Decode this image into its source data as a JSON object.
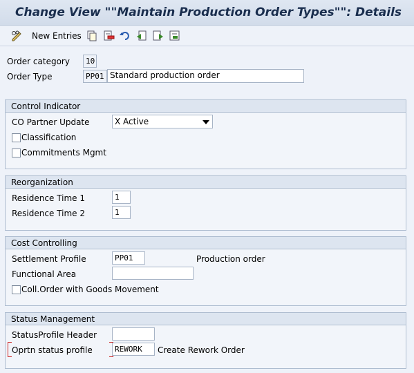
{
  "window": {
    "title": "Change View \"\"Maintain Production Order Types\"\": Details"
  },
  "toolbar": {
    "new_entries_label": "New Entries",
    "icons": [
      "display-change-icon",
      "copy-icon",
      "delete-icon",
      "undo-icon",
      "previous-entry-icon",
      "next-entry-icon",
      "transport-icon"
    ]
  },
  "header": {
    "order_category_label": "Order category",
    "order_category_value": "10",
    "order_type_label": "Order Type",
    "order_type_value": "PP01",
    "order_type_desc": "Standard production order"
  },
  "control_indicator": {
    "title": "Control Indicator",
    "co_partner_label": "CO Partner Update",
    "co_partner_value": "X Active",
    "classification_label": "Classification",
    "classification_checked": false,
    "commitments_label": "Commitments Mgmt",
    "commitments_checked": false
  },
  "reorganization": {
    "title": "Reorganization",
    "residence1_label": "Residence Time 1",
    "residence1_value": "1",
    "residence2_label": "Residence Time 2",
    "residence2_value": "1"
  },
  "cost_controlling": {
    "title": "Cost Controlling",
    "settlement_label": "Settlement Profile",
    "settlement_value": "PP01",
    "settlement_desc": "Production order",
    "functional_area_label": "Functional Area",
    "functional_area_value": "",
    "coll_order_label": "Coll.Order with Goods Movement",
    "coll_order_checked": false
  },
  "status_management": {
    "title": "Status Management",
    "header_profile_label": "StatusProfile Header",
    "header_profile_value": "",
    "oprtn_profile_label": "Oprtn status profile",
    "oprtn_profile_value": "REWORK",
    "oprtn_profile_desc": "Create Rework Order"
  },
  "colors": {
    "background": "#eef2f9",
    "title": "#1a2e4e",
    "group_header": "#dde5f0",
    "required_mark": "#cc2222"
  }
}
